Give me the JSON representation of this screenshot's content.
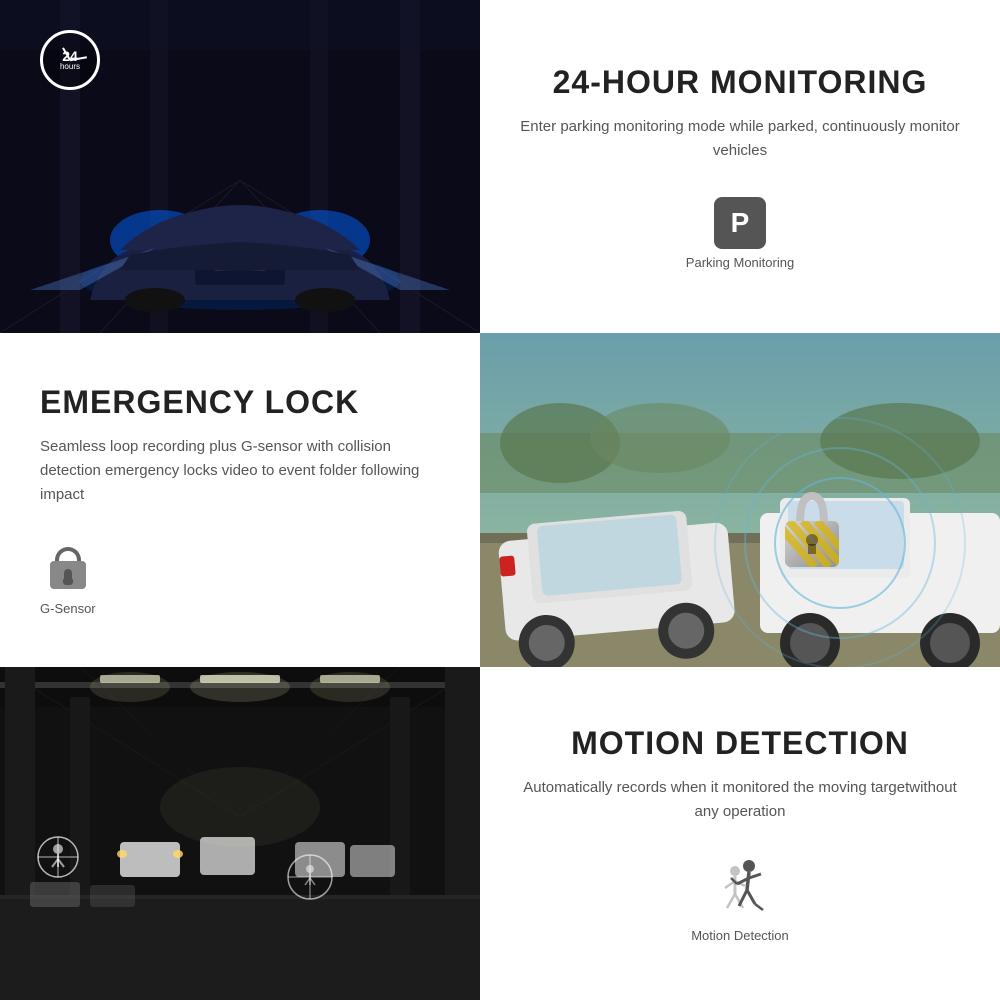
{
  "sections": {
    "top_right": {
      "title": "24-HOUR MONITORING",
      "description": "Enter parking monitoring mode while parked, continuously monitor vehicles",
      "icon_label": "Parking Monitoring",
      "icon_type": "parking"
    },
    "mid_left": {
      "title": "EMERGENCY LOCK",
      "description": "Seamless loop recording plus G-sensor with collision detection emergency locks video to event folder following impact",
      "icon_label": "G-Sensor",
      "icon_type": "lock"
    },
    "bottom_right": {
      "title": "MOTION DETECTION",
      "description": "Automatically records when it monitored the moving targetwithout any operation",
      "icon_label": "Motion Detection",
      "icon_type": "motion"
    }
  },
  "clock": {
    "label_big": "24",
    "label_small": "hours"
  }
}
